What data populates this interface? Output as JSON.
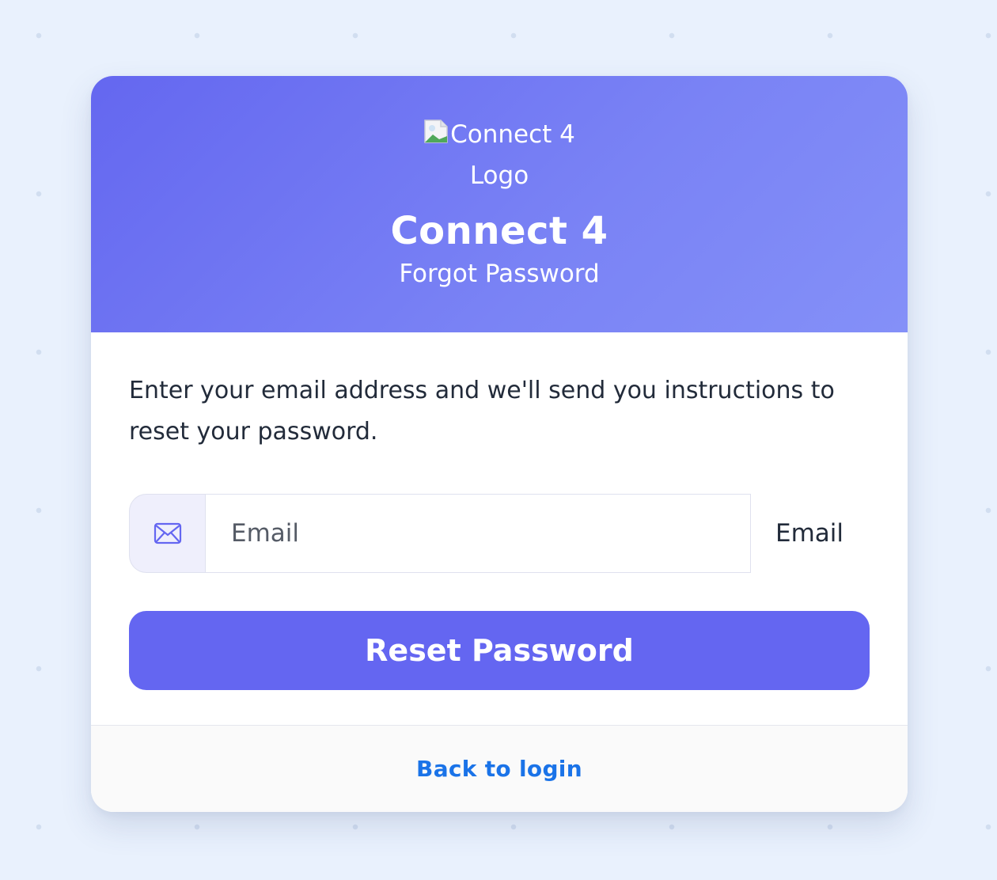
{
  "header": {
    "logo_alt_line1": "Connect 4",
    "logo_alt_line2": "Logo",
    "brand": "Connect 4",
    "subtitle": "Forgot Password"
  },
  "body": {
    "instructions": "Enter your email address and we'll send you instructions to reset your password.",
    "email": {
      "placeholder": "Email",
      "value": "",
      "label": "Email",
      "icon": "envelope-icon"
    },
    "submit_label": "Reset Password"
  },
  "footer": {
    "back_link": "Back to login"
  },
  "colors": {
    "background": "#e9f1fd",
    "header_gradient_start": "#6467f0",
    "header_gradient_end": "#8490f8",
    "accent": "#6466f1",
    "link": "#1a73e8"
  }
}
